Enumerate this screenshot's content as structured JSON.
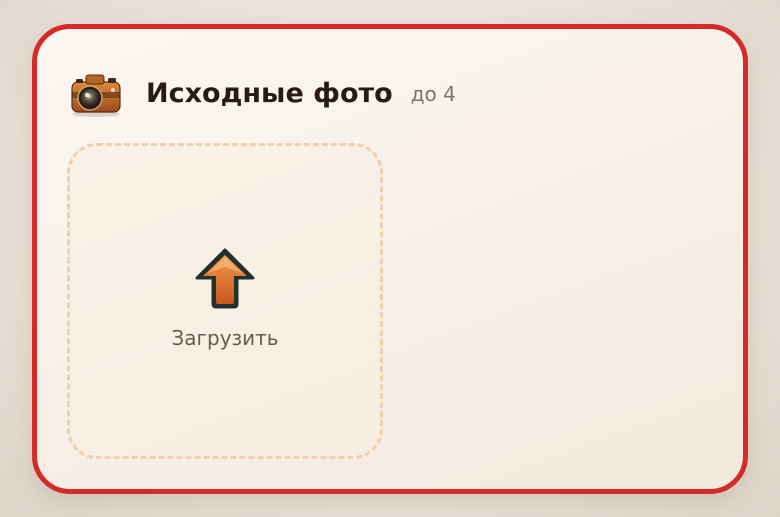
{
  "panel": {
    "title": "Исходные фото",
    "limit": "до 4",
    "icon": "camera-icon"
  },
  "upload": {
    "label": "Загрузить",
    "icon": "upload-arrow-icon",
    "count": 0
  },
  "colors": {
    "border": "#d42a28",
    "card_background": "#f8f2ea",
    "dashed_border": "#efcfad",
    "accent_orange": "#e07a2e"
  }
}
